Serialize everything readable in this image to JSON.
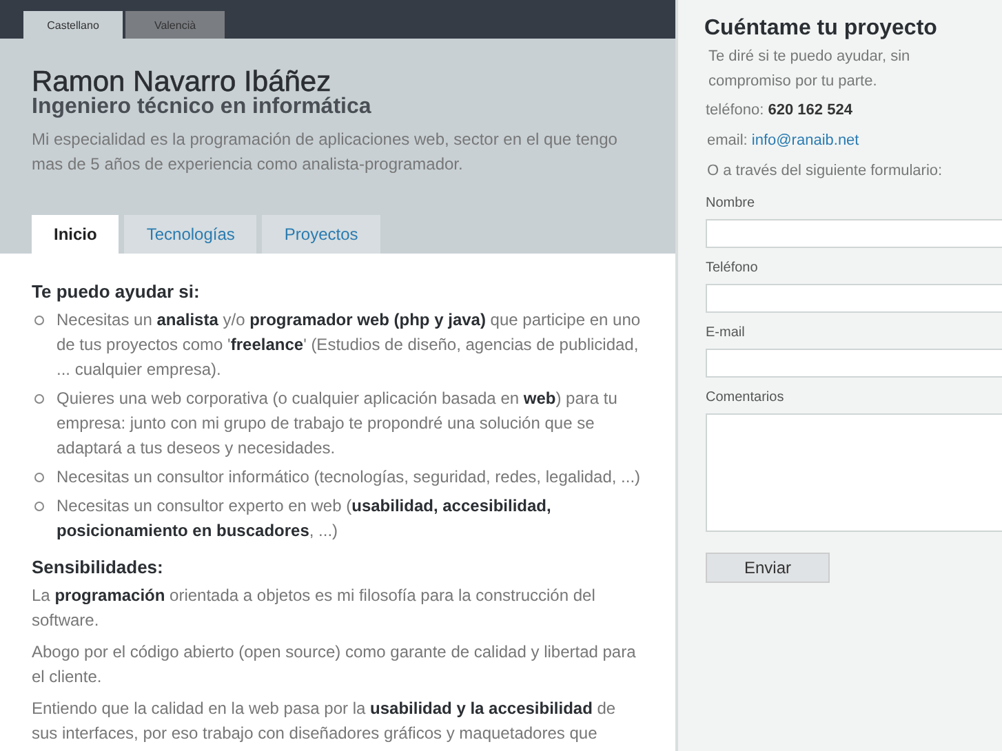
{
  "languages": [
    {
      "label": "Castellano",
      "selected": true
    },
    {
      "label": "Valencià",
      "selected": false
    }
  ],
  "header": {
    "name": "Ramon Navarro Ibáñez",
    "subtitle": "Ingeniero técnico en informática",
    "intro": "Mi especialidad es la programación de aplicaciones web, sector en el que tengo mas de 5 años de experiencia como analista-programador."
  },
  "tabs": [
    {
      "label": "Inicio",
      "selected": true
    },
    {
      "label": "Tecnologías",
      "selected": false
    },
    {
      "label": "Proyectos",
      "selected": false
    }
  ],
  "help": {
    "heading": "Te puedo ayudar si:",
    "items": [
      "Necesitas un **analista** y/o **programador web (php y java)** que participe en uno de tus proyectos como '**freelance**' (Estudios de diseño, agencias de publicidad, ... cualquier empresa).",
      "Quieres una web corporativa (o cualquier aplicación basada en **web**) para tu empresa: junto con mi grupo de trabajo te propondré una solución que se adaptará a tus deseos y necesidades.",
      "Necesitas un consultor informático (tecnologías, seguridad, redes, legalidad, ...)",
      "Necesitas un consultor experto en web (**usabilidad, accesibilidad, posicionamiento en buscadores**, ...)"
    ]
  },
  "sensibilidades": {
    "heading": "Sensibilidades:",
    "paragraphs": [
      "La **programación** orientada a objetos es mi filosofía para la construcción del software.",
      "Abogo por el código abierto (open source) como garante de calidad y libertad para el cliente.",
      "Entiendo que la calidad en la web pasa por la **usabilidad y la accesibilidad** de sus interfaces, por eso trabajo con diseñadores gráficos y maquetadores que"
    ]
  },
  "contact": {
    "title": "Cuéntame tu proyecto",
    "intro": "Te diré si te puedo ayudar, sin compromiso por tu parte.",
    "phone_label": "teléfono:",
    "phone": "620 162 524",
    "email_label": "email:",
    "email": "info@ranaib.net",
    "form_intro": "O a través del siguiente formulario:",
    "fields": [
      {
        "label": "Nombre",
        "kind": "text"
      },
      {
        "label": "Teléfono",
        "kind": "text"
      },
      {
        "label": "E-mail",
        "kind": "text"
      },
      {
        "label": "Comentarios",
        "kind": "textarea"
      }
    ],
    "submit": "Enviar"
  }
}
